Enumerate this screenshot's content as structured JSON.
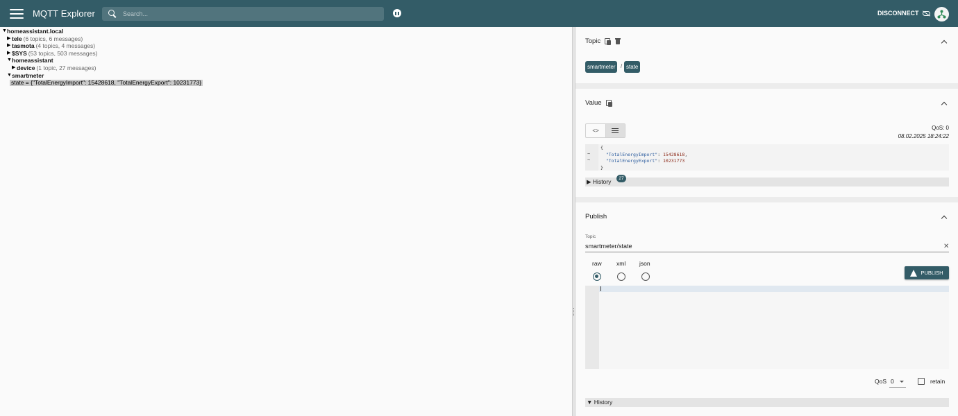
{
  "app": {
    "title": "MQTT Explorer"
  },
  "search": {
    "placeholder": "Search..."
  },
  "header": {
    "disconnect_label": "DISCONNECT"
  },
  "tree": {
    "root": "homeassistant.local",
    "nodes": [
      {
        "name": "tele",
        "meta": "(6 topics, 6 messages)"
      },
      {
        "name": "tasmota",
        "meta": "(4 topics, 4 messages)"
      },
      {
        "name": "$SYS",
        "meta": "(53 topics, 503 messages)"
      },
      {
        "name": "homeassistant",
        "meta": ""
      },
      {
        "name": "device",
        "meta": "(1 topic, 27 messages)"
      },
      {
        "name": "smartmeter",
        "meta": ""
      }
    ],
    "leaf": "state = {\"TotalEnergyImport\": 15428618, \"TotalEnergyExport\": 10231773}"
  },
  "topic_panel": {
    "title": "Topic",
    "chips": [
      "smartmeter",
      "state"
    ],
    "separator": "/"
  },
  "value_panel": {
    "title": "Value",
    "toggle_code": "<>",
    "qos": "QoS: 0",
    "date": "08.02.2025 18:24:22",
    "code_open": "{",
    "key1": "\"TotalEnergyImport\"",
    "val1": "15428618",
    "key2": "\"TotalEnergyExport\"",
    "val2": "10231773",
    "code_close": "}",
    "history_label": "History",
    "history_count": "27"
  },
  "publish_panel": {
    "title": "Publish",
    "topic_label": "Topic",
    "topic_value": "smartmeter/state",
    "formats": [
      "raw",
      "xml",
      "json"
    ],
    "selected_format": "raw",
    "publish_label": "PUBLISH",
    "qos_label": "QoS",
    "qos_value": "0",
    "retain_label": "retain",
    "history_label": "History"
  },
  "colors": {
    "primary": "#335c67",
    "background": "#fafafa"
  }
}
